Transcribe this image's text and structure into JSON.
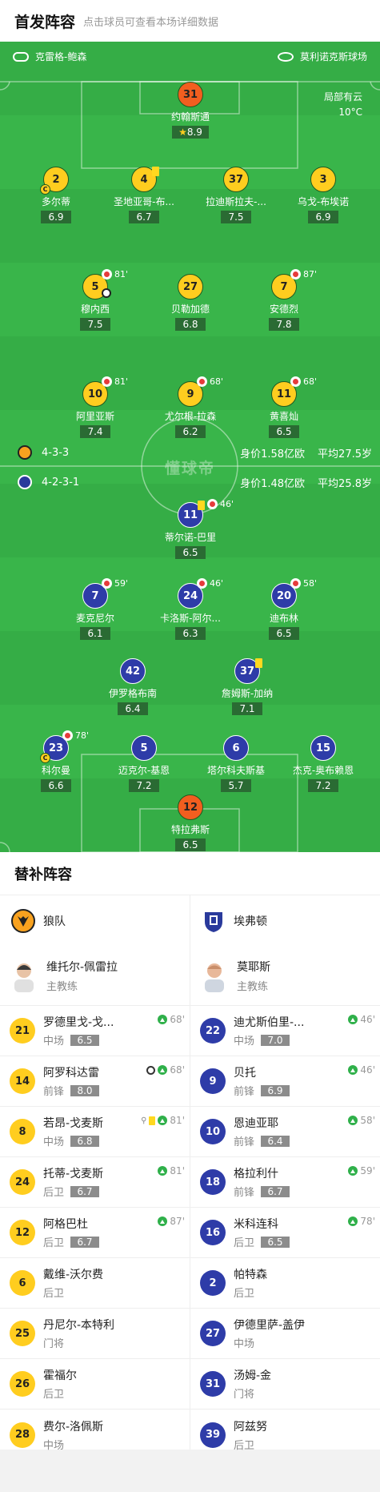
{
  "header": {
    "title": "首发阵容",
    "subtitle": "点击球员可查看本场详细数据"
  },
  "field": {
    "coach_home": "克雷格-鲍森",
    "venue": "莫利诺克斯球场",
    "weather": "局部有云",
    "temperature": "10°C",
    "watermark": "懂球帝",
    "home_team": {
      "formation": "4-3-3",
      "value": "身价1.58亿欧",
      "age": "平均27.5岁"
    },
    "away_team": {
      "formation": "4-2-3-1",
      "value": "身价1.48亿欧",
      "age": "平均25.8岁"
    }
  },
  "home_players": [
    {
      "num": "31",
      "name": "约翰斯通",
      "rating": "8.9",
      "color": "orange"
    },
    {
      "num": "2",
      "name": "多尔蒂",
      "rating": "6.9"
    },
    {
      "num": "4",
      "name": "圣地亚哥-布...",
      "rating": "6.7"
    },
    {
      "num": "37",
      "name": "拉迪斯拉夫-...",
      "rating": "7.5"
    },
    {
      "num": "3",
      "name": "乌戈-布埃诺",
      "rating": "6.9"
    },
    {
      "num": "5",
      "name": "穆内西",
      "rating": "7.5",
      "sub": "81'"
    },
    {
      "num": "27",
      "name": "贝勒加德",
      "rating": "6.8"
    },
    {
      "num": "7",
      "name": "安德烈",
      "rating": "7.8",
      "sub": "87'"
    },
    {
      "num": "10",
      "name": "阿里亚斯",
      "rating": "7.4",
      "sub": "81'"
    },
    {
      "num": "9",
      "name": "尤尔根-拉森",
      "rating": "6.2",
      "sub": "68'"
    },
    {
      "num": "11",
      "name": "黄喜灿",
      "rating": "6.5",
      "sub": "68'"
    }
  ],
  "away_players": [
    {
      "num": "11",
      "name": "蒂尔诺-巴里",
      "rating": "6.5",
      "sub": "46'"
    },
    {
      "num": "7",
      "name": "麦克尼尔",
      "rating": "6.1",
      "sub": "59'"
    },
    {
      "num": "24",
      "name": "卡洛斯-阿尔...",
      "rating": "6.3",
      "sub": "46'"
    },
    {
      "num": "20",
      "name": "迪布林",
      "rating": "6.5",
      "sub": "58'"
    },
    {
      "num": "42",
      "name": "伊罗格布南",
      "rating": "6.4"
    },
    {
      "num": "37",
      "name": "詹姆斯-加纳",
      "rating": "7.1"
    },
    {
      "num": "23",
      "name": "科尔曼",
      "rating": "6.6",
      "sub": "78'"
    },
    {
      "num": "5",
      "name": "迈克尔-基恩",
      "rating": "7.2"
    },
    {
      "num": "6",
      "name": "塔尔科夫斯基",
      "rating": "5.7"
    },
    {
      "num": "15",
      "name": "杰克-奥布赖恩",
      "rating": "7.2"
    },
    {
      "num": "12",
      "name": "特拉弗斯",
      "rating": "6.5",
      "color": "orange"
    }
  ],
  "subs": {
    "title": "替补阵容",
    "home": {
      "team": "狼队",
      "coach": {
        "name": "维托尔-佩雷拉",
        "role": "主教练"
      },
      "players": [
        {
          "num": "21",
          "name": "罗德里戈-戈...",
          "pos": "中场",
          "rating": "6.5",
          "time": "68'"
        },
        {
          "num": "14",
          "name": "阿罗科达雷",
          "pos": "前锋",
          "rating": "8.0",
          "time": "68'"
        },
        {
          "num": "8",
          "name": "若昂-戈麦斯",
          "pos": "中场",
          "rating": "6.8",
          "time": "81'"
        },
        {
          "num": "24",
          "name": "托蒂-戈麦斯",
          "pos": "后卫",
          "rating": "6.7",
          "time": "81'"
        },
        {
          "num": "12",
          "name": "阿格巴杜",
          "pos": "后卫",
          "rating": "6.7",
          "time": "87'"
        },
        {
          "num": "6",
          "name": "戴维-沃尔费",
          "pos": "后卫"
        },
        {
          "num": "25",
          "name": "丹尼尔-本特利",
          "pos": "门将"
        },
        {
          "num": "26",
          "name": "霍福尔",
          "pos": "后卫"
        },
        {
          "num": "28",
          "name": "费尔-洛佩斯",
          "pos": "中场"
        }
      ]
    },
    "away": {
      "team": "埃弗顿",
      "coach": {
        "name": "莫耶斯",
        "role": "主教练"
      },
      "players": [
        {
          "num": "22",
          "name": "迪尤斯伯里-...",
          "pos": "中场",
          "rating": "7.0",
          "time": "46'"
        },
        {
          "num": "9",
          "name": "贝托",
          "pos": "前锋",
          "rating": "6.9",
          "time": "46'"
        },
        {
          "num": "10",
          "name": "恩迪亚耶",
          "pos": "前锋",
          "rating": "6.4",
          "time": "58'"
        },
        {
          "num": "18",
          "name": "格拉利什",
          "pos": "前锋",
          "rating": "6.7",
          "time": "59'"
        },
        {
          "num": "16",
          "name": "米科连科",
          "pos": "后卫",
          "rating": "6.5",
          "time": "78'"
        },
        {
          "num": "2",
          "name": "帕特森",
          "pos": "后卫"
        },
        {
          "num": "27",
          "name": "伊德里萨-盖伊",
          "pos": "中场"
        },
        {
          "num": "31",
          "name": "汤姆-金",
          "pos": "门将"
        },
        {
          "num": "39",
          "name": "阿兹努",
          "pos": "后卫"
        }
      ]
    }
  }
}
